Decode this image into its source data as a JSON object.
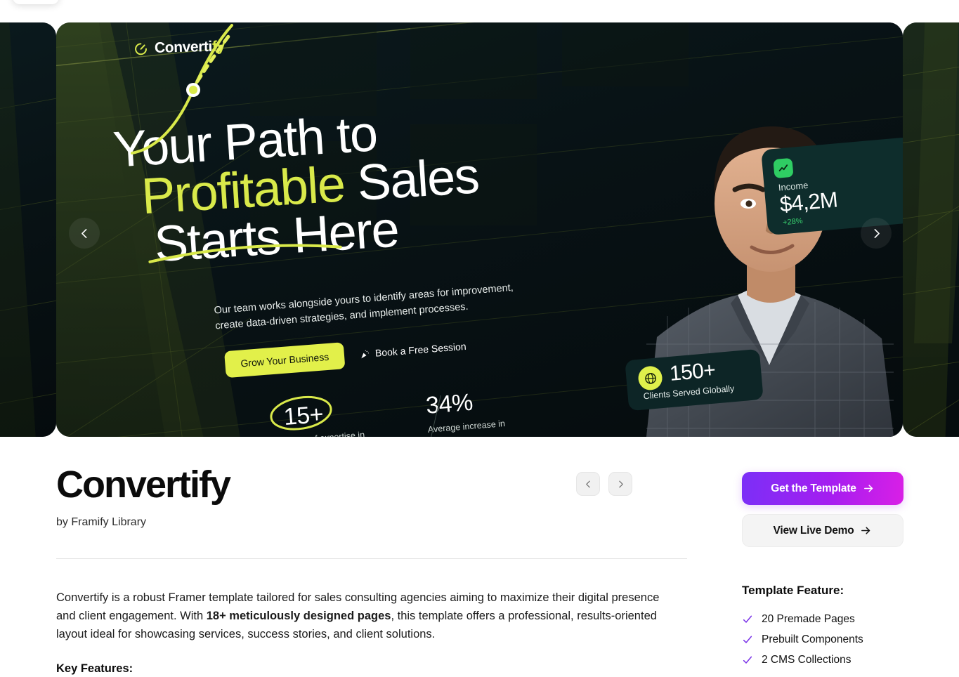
{
  "hero": {
    "logo_text": "Converti",
    "logo_text_accent": "fy",
    "logo_icon": "circular-arrow-icon",
    "headline_line1": "Your Path to",
    "headline_accent": "Profitable",
    "headline_line2_rest": " Sales",
    "headline_line3": "Starts Here",
    "subtitle": "Our team works alongside yours to identify areas for improvement, create data-driven strategies, and implement processes.",
    "cta_primary": "Grow Your Business",
    "cta_secondary": "Book a Free Session",
    "cta_secondary_icon": "party-popper-icon",
    "stats": [
      {
        "value": "15+",
        "label": "Years of expertise in industries"
      },
      {
        "value": "34%",
        "label": "Average increase in revenue"
      }
    ],
    "income_card": {
      "icon": "trending-up-icon",
      "label": "Income",
      "value": "$4,2M",
      "delta": "+28%"
    },
    "clients_card": {
      "icon": "globe-icon",
      "value": "150+",
      "label": "Clients Served Globally"
    },
    "prev_icon": "chevron-left-icon",
    "next_icon": "chevron-right-icon",
    "dots": [
      {
        "active": true
      },
      {
        "active": false
      },
      {
        "active": false
      }
    ],
    "colors": {
      "lime": "#d9e94a",
      "background": "#081215",
      "card_teal": "#0e2d2c",
      "green": "#2fcd63"
    }
  },
  "detail": {
    "title": "Convertify",
    "byline": "by Framify Library",
    "description_part1": "Convertify is a robust Framer template tailored for sales consulting agencies aiming to maximize their digital presence and client engagement. With ",
    "description_bold": "18+ meticulously designed pages",
    "description_part2": ", this template offers a professional, results-oriented layout ideal for showcasing services, success stories, and client solutions.",
    "key_features_heading": "Key Features:",
    "gallery_prev_icon": "chevron-left-icon",
    "gallery_next_icon": "chevron-right-icon"
  },
  "sidebar": {
    "get_template_label": "Get the Template",
    "get_template_icon": "arrow-right-icon",
    "live_demo_label": "View Live Demo",
    "live_demo_icon": "arrow-right-icon",
    "feature_heading": "Template Feature:",
    "features": [
      {
        "label": "20 Premade Pages",
        "icon": "check-icon"
      },
      {
        "label": "Prebuilt Components",
        "icon": "check-icon"
      },
      {
        "label": "2 CMS Collections",
        "icon": "check-icon"
      }
    ],
    "accent_gradient_from": "#7B2FF7",
    "accent_gradient_to": "#D91FE6",
    "check_color": "#7B35E8"
  }
}
